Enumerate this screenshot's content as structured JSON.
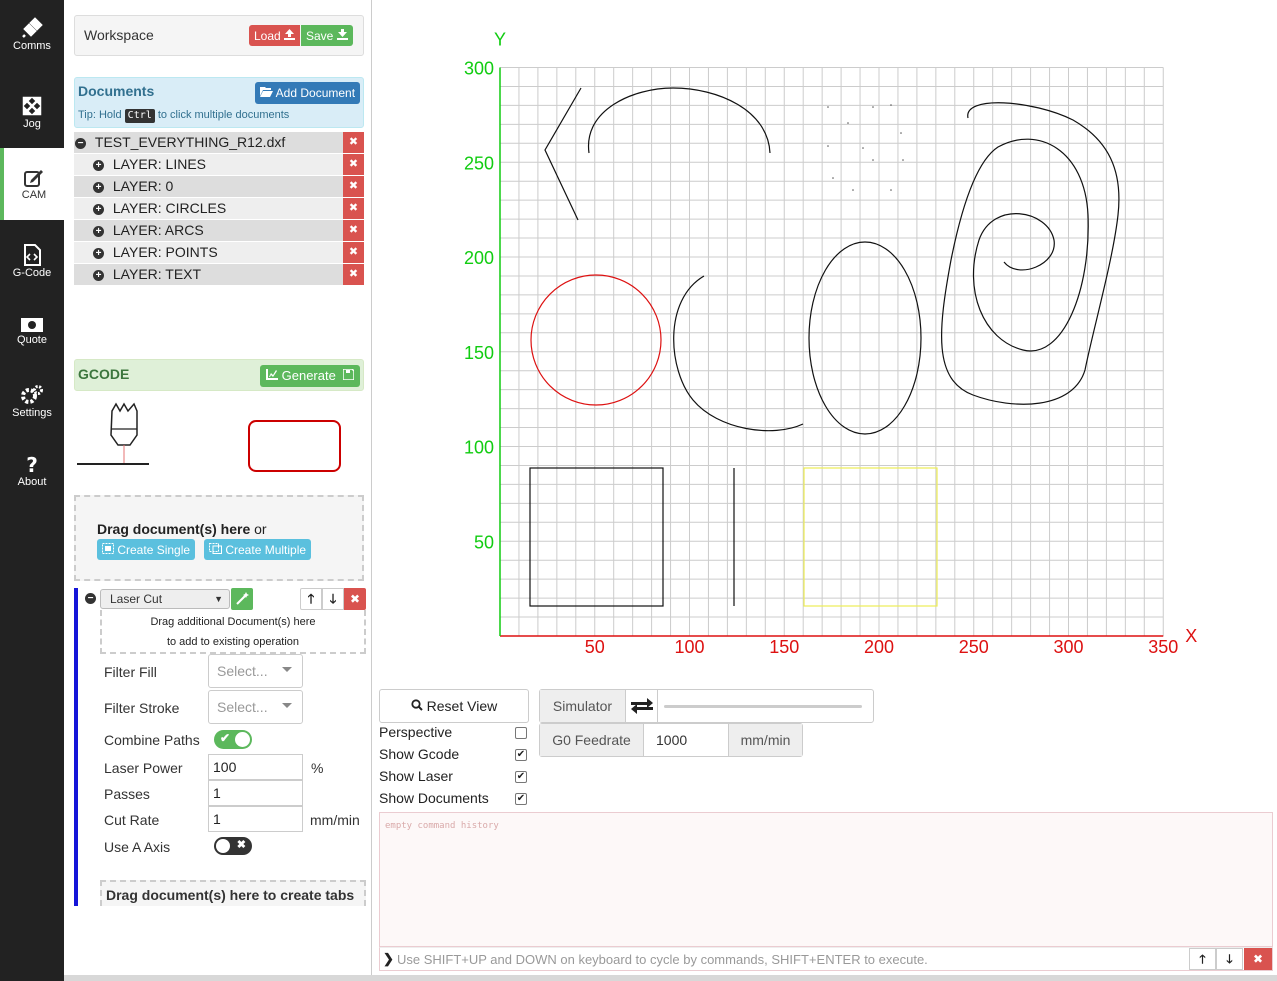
{
  "nav": {
    "items": [
      {
        "label": "Comms",
        "icon": "plug-icon"
      },
      {
        "label": "Jog",
        "icon": "arrows-icon"
      },
      {
        "label": "CAM",
        "icon": "edit-icon"
      },
      {
        "label": "G-Code",
        "icon": "code-file-icon"
      },
      {
        "label": "Quote",
        "icon": "money-icon"
      },
      {
        "label": "Settings",
        "icon": "cogs-icon"
      },
      {
        "label": "About",
        "icon": "question-icon"
      }
    ]
  },
  "workspace": {
    "title": "Workspace",
    "load_label": "Load",
    "save_label": "Save"
  },
  "documents": {
    "title": "Documents",
    "add_label": "Add Document",
    "tip_prefix": "Tip: Hold",
    "tip_key": "Ctrl",
    "tip_suffix": "to click multiple documents",
    "root": "TEST_EVERYTHING_R12.dxf",
    "layers": [
      "LAYER: LINES",
      "LAYER: 0",
      "LAYER: CIRCLES",
      "LAYER: ARCS",
      "LAYER: POINTS",
      "LAYER: TEXT"
    ]
  },
  "gcode": {
    "title": "GCODE",
    "generate_label": "Generate"
  },
  "dropzone": {
    "text": "Drag document(s) here",
    "or": "or",
    "create_single": "Create Single",
    "create_multiple": "Create Multiple"
  },
  "operation": {
    "type": "Laser Cut",
    "drag_line1": "Drag additional Document(s) here",
    "drag_line2": "to add to existing operation",
    "filter_fill_label": "Filter Fill",
    "filter_fill_placeholder": "Select...",
    "filter_stroke_label": "Filter Stroke",
    "filter_stroke_placeholder": "Select...",
    "combine_paths_label": "Combine Paths",
    "laser_power_label": "Laser Power",
    "laser_power_value": "100",
    "laser_power_unit": "%",
    "passes_label": "Passes",
    "passes_value": "1",
    "cut_rate_label": "Cut Rate",
    "cut_rate_value": "1",
    "cut_rate_unit": "mm/min",
    "use_a_axis_label": "Use A Axis",
    "tabs_drop": "Drag document(s) here to create tabs"
  },
  "canvas": {
    "x_axis_label": "X",
    "y_axis_label": "Y",
    "x_ticks": [
      "50",
      "100",
      "150",
      "200",
      "250",
      "300",
      "350"
    ],
    "y_ticks": [
      "50",
      "100",
      "150",
      "200",
      "250",
      "300"
    ],
    "x_color": "#dd1111",
    "y_color": "#11cc11"
  },
  "controls": {
    "reset_view": "Reset View",
    "simulator": "Simulator",
    "g0_label": "G0 Feedrate",
    "g0_value": "1000",
    "g0_unit": "mm/min",
    "checks": [
      {
        "label": "Perspective",
        "checked": false
      },
      {
        "label": "Show Gcode",
        "checked": true
      },
      {
        "label": "Show Laser",
        "checked": true
      },
      {
        "label": "Show Documents",
        "checked": true
      }
    ]
  },
  "console": {
    "history_placeholder": "empty command history",
    "input_placeholder": "Use SHIFT+UP and DOWN on keyboard to cycle by commands, SHIFT+ENTER to execute."
  }
}
